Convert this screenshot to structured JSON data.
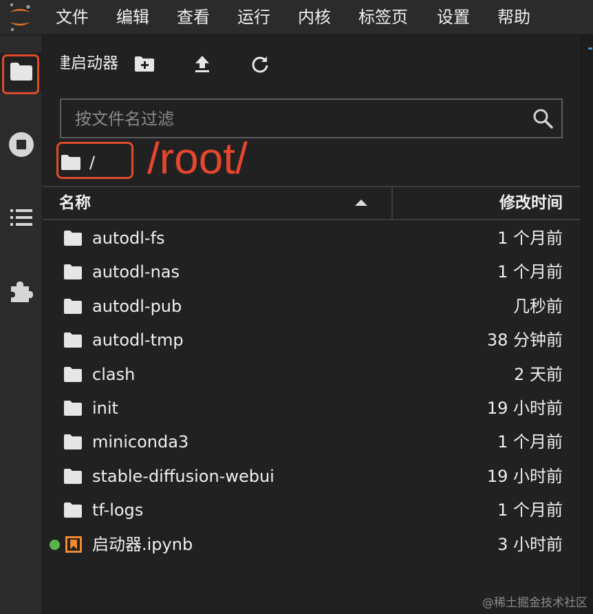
{
  "menubar": {
    "items": [
      "文件",
      "编辑",
      "查看",
      "运行",
      "内核",
      "标签页",
      "设置",
      "帮助"
    ]
  },
  "activity_bar": {
    "icons": [
      "folder-icon",
      "stop-circle-icon",
      "list-icon",
      "puzzle-icon"
    ]
  },
  "file_browser": {
    "toolbar_label": "新建启动器",
    "filter_placeholder": "按文件名过滤",
    "filter_value": "",
    "breadcrumb": "/",
    "annotation": "/root/",
    "columns": {
      "name": "名称",
      "modified": "修改时间"
    },
    "files": [
      {
        "name": "autodl-fs",
        "modified": "1 个月前",
        "type": "folder"
      },
      {
        "name": "autodl-nas",
        "modified": "1 个月前",
        "type": "folder"
      },
      {
        "name": "autodl-pub",
        "modified": "几秒前",
        "type": "folder"
      },
      {
        "name": "autodl-tmp",
        "modified": "38 分钟前",
        "type": "folder"
      },
      {
        "name": "clash",
        "modified": "2 天前",
        "type": "folder"
      },
      {
        "name": "init",
        "modified": "19 小时前",
        "type": "folder"
      },
      {
        "name": "miniconda3",
        "modified": "1 个月前",
        "type": "folder"
      },
      {
        "name": "stable-diffusion-webui",
        "modified": "19 小时前",
        "type": "folder"
      },
      {
        "name": "tf-logs",
        "modified": "1 个月前",
        "type": "folder"
      },
      {
        "name": "启动器.ipynb",
        "modified": "3 小时前",
        "type": "notebook",
        "running": true
      }
    ]
  },
  "colors": {
    "accent_orange": "#e5462d",
    "running_green": "#5bb44b",
    "notebook_orange": "#f28b30"
  },
  "watermark": "@稀土掘金技术社区"
}
